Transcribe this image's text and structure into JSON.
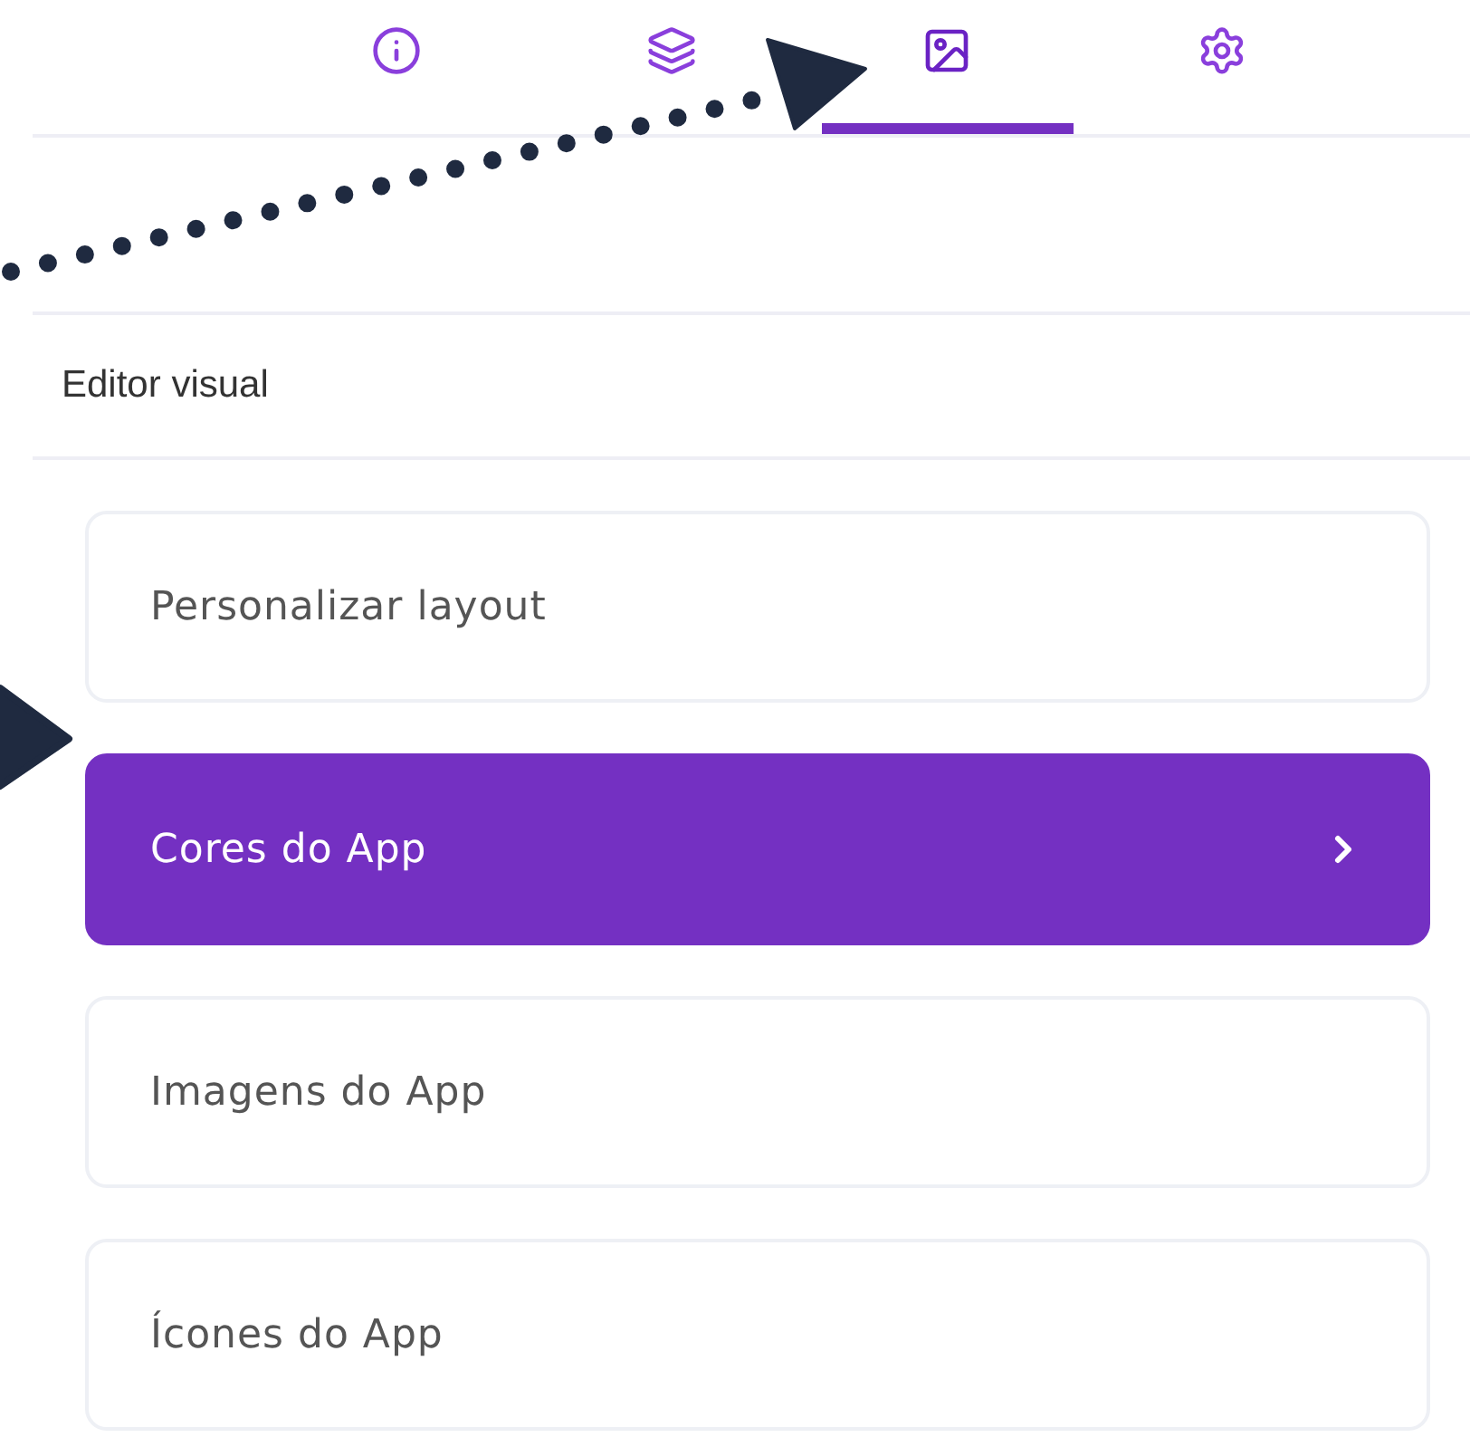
{
  "tabs": [
    {
      "kind": "info",
      "selected": false
    },
    {
      "kind": "layers",
      "selected": false
    },
    {
      "kind": "image",
      "selected": true
    },
    {
      "kind": "settings",
      "selected": false
    }
  ],
  "section": {
    "title": "Editor visual"
  },
  "menu": [
    {
      "label": "Personalizar layout",
      "selected": false
    },
    {
      "label": "Cores do App",
      "selected": true
    },
    {
      "label": "Imagens do App",
      "selected": false
    },
    {
      "label": "Ícones do App",
      "selected": false
    }
  ]
}
